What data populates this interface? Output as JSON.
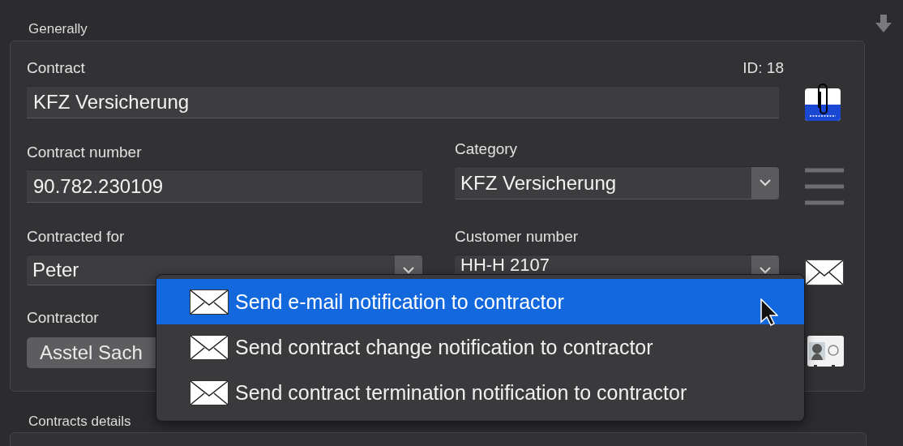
{
  "generally": {
    "title": "Generally",
    "id_label": "ID: 18",
    "contract": {
      "label": "Contract",
      "value": "KFZ Versicherung"
    },
    "contract_number": {
      "label": "Contract number",
      "value": "90.782.230109"
    },
    "category": {
      "label": "Category",
      "value": "KFZ Versicherung"
    },
    "contracted_for": {
      "label": "Contracted for",
      "value": "Peter"
    },
    "customer_number": {
      "label": "Customer number",
      "value": "HH-H 2107"
    },
    "contractor": {
      "label": "Contractor",
      "value": "Asstel Sach"
    }
  },
  "notification_menu": {
    "items": [
      {
        "label": "Send e-mail notification to contractor",
        "selected": true
      },
      {
        "label": "Send contract change notification to contractor",
        "selected": false
      },
      {
        "label": "Send contract termination notification to contractor",
        "selected": false
      }
    ]
  },
  "contracts_details": {
    "title": "Contracts details"
  }
}
